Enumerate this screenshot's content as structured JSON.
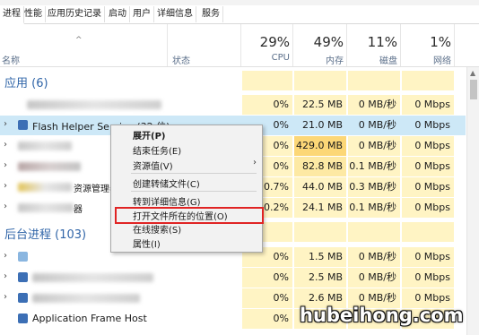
{
  "tabs": [
    "进程",
    "性能",
    "应用历史记录",
    "启动",
    "用户",
    "详细信息",
    "服务"
  ],
  "header": {
    "columns": [
      {
        "pct": "29%",
        "name": "CPU"
      },
      {
        "pct": "49%",
        "name": "内存"
      },
      {
        "pct": "11%",
        "name": "磁盘"
      },
      {
        "pct": "1%",
        "name": "网络"
      }
    ],
    "name_col": "名称",
    "status_col": "状态",
    "sort_arrow": "^"
  },
  "groups": {
    "apps": "应用 (6)",
    "background": "后台进程 (103)"
  },
  "rows": [
    {
      "name": "",
      "cpu": "0%",
      "mem": "22.5 MB",
      "disk": "0 MB/秒",
      "net": "0 Mbps"
    },
    {
      "name": "Flash Helper Service (32 位)",
      "cpu": "0%",
      "mem": "21.0 MB",
      "disk": "0 MB/秒",
      "net": "0 Mbps"
    },
    {
      "name": "",
      "cpu": "0%",
      "mem": "429.0 MB",
      "disk": "0 MB/秒",
      "net": "0 Mbps"
    },
    {
      "name": "",
      "cpu": "0%",
      "mem": "82.8 MB",
      "disk": "0.1 MB/秒",
      "net": "0 Mbps"
    },
    {
      "name": "资源管理器",
      "cpu": "0.7%",
      "mem": "44.0 MB",
      "disk": "0.3 MB/秒",
      "net": "0 Mbps"
    },
    {
      "name": "器",
      "cpu": "0.2%",
      "mem": "24.1 MB",
      "disk": "0.1 MB/秒",
      "net": "0 Mbps"
    },
    {
      "name": "",
      "cpu": "0%",
      "mem": "1.5 MB",
      "disk": "0 MB/秒",
      "net": "0 Mbps"
    },
    {
      "name": "",
      "cpu": "0%",
      "mem": "2.5 MB",
      "disk": "0 MB/秒",
      "net": "0 Mbps"
    },
    {
      "name": "",
      "cpu": "0%",
      "mem": "2.6 MB",
      "disk": "0 MB/秒",
      "net": "0 Mbps"
    },
    {
      "name": "Application Frame Host",
      "cpu": "0%",
      "mem": "",
      "disk": "",
      "net": ""
    }
  ],
  "context_menu": {
    "items": [
      "展开(P)",
      "结束任务(E)",
      "资源值(V)",
      "创建转储文件(C)",
      "转到详细信息(G)",
      "打开文件所在的位置(O)",
      "在线搜索(S)",
      "属性(I)"
    ],
    "submenu_arrow": "›"
  },
  "watermark": "hubeihong.com"
}
